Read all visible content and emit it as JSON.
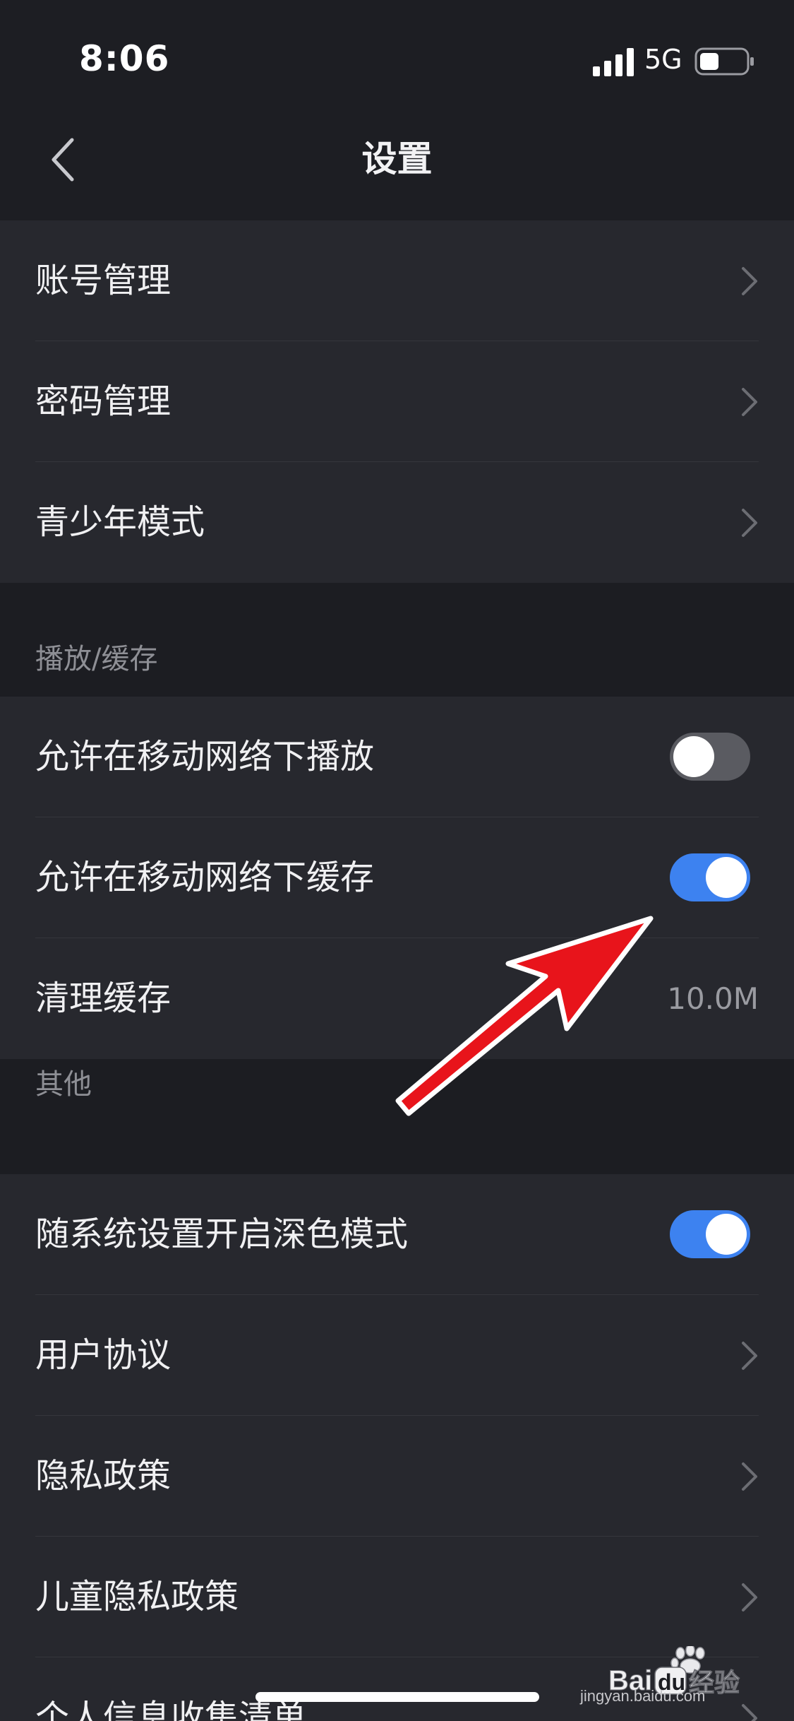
{
  "status_bar": {
    "time": "8:06",
    "network": "5G"
  },
  "header": {
    "title": "设置"
  },
  "groups": [
    {
      "items": [
        {
          "label": "账号管理",
          "control": "chevron"
        },
        {
          "label": "密码管理",
          "control": "chevron"
        },
        {
          "label": "青少年模式",
          "control": "chevron"
        }
      ]
    },
    {
      "header": "播放/缓存",
      "items": [
        {
          "label": "允许在移动网络下播放",
          "control": "toggle",
          "on": false
        },
        {
          "label": "允许在移动网络下缓存",
          "control": "toggle",
          "on": true
        },
        {
          "label": "清理缓存",
          "control": "value",
          "value": "10.0M"
        }
      ]
    },
    {
      "header": "其他",
      "items": [
        {
          "label": "随系统设置开启深色模式",
          "control": "toggle",
          "on": true
        },
        {
          "label": "用户协议",
          "control": "chevron"
        },
        {
          "label": "隐私政策",
          "control": "chevron"
        },
        {
          "label": "儿童隐私政策",
          "control": "chevron"
        },
        {
          "label": "个人信息收集清单",
          "control": "chevron"
        }
      ]
    }
  ],
  "watermark": {
    "brand": "Baidu经验",
    "url": "jingyan.baidu.com"
  },
  "colors": {
    "background": "#1c1d22",
    "row_background": "#27282e",
    "toggle_on": "#3d82f0",
    "toggle_off": "#5a5b61",
    "annotation_arrow": "#e8141b"
  }
}
